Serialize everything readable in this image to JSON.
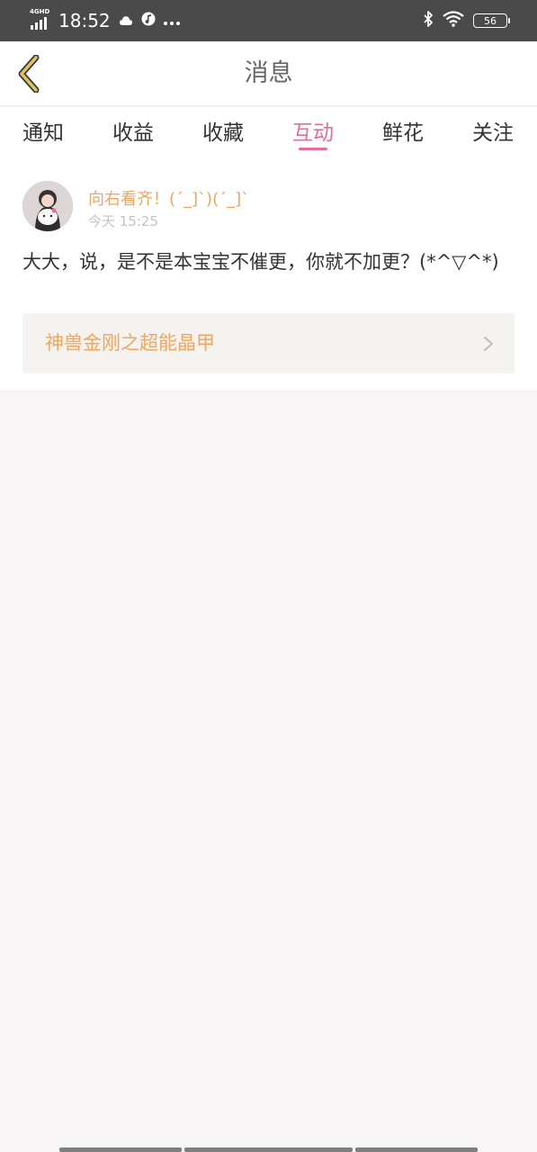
{
  "status_bar": {
    "network": "4GHD",
    "time": "18:52",
    "battery": "56"
  },
  "header": {
    "title": "消息"
  },
  "tabs": [
    {
      "label": "通知"
    },
    {
      "label": "收益"
    },
    {
      "label": "收藏"
    },
    {
      "label": "互动",
      "active": true
    },
    {
      "label": "鲜花"
    },
    {
      "label": "关注"
    }
  ],
  "message": {
    "username": "向右看齐！(´_]`)(´_]`",
    "time": "今天 15:25",
    "content": "大大，说，是不是本宝宝不催更，你就不加更？(*^▽^*)",
    "book_title": "神兽金刚之超能晶甲"
  },
  "colors": {
    "accent": "#e46d9b",
    "username": "#f0a560",
    "back_icon": "#e0c35a"
  }
}
